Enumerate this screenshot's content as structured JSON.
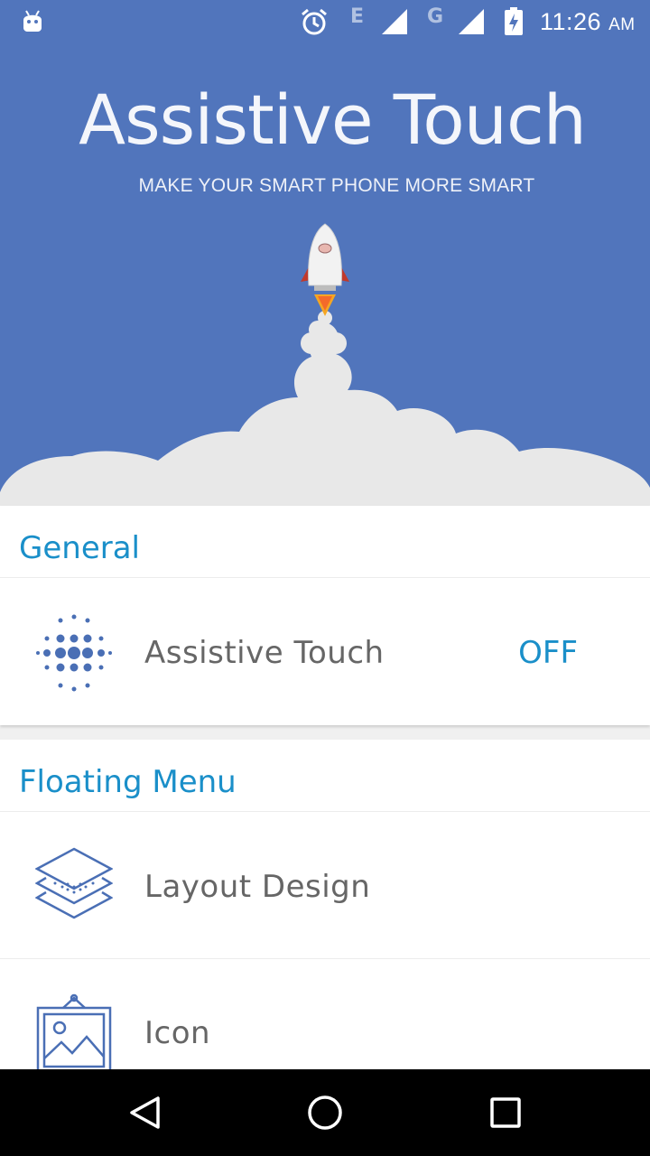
{
  "status_bar": {
    "time": "11:26",
    "ampm": "AM",
    "network_1": "E",
    "network_2": "G",
    "icons": [
      "android-icon",
      "alarm-icon",
      "signal-icon",
      "signal-icon",
      "battery-charging-icon"
    ]
  },
  "hero": {
    "title": "Assistive Touch",
    "subtitle": "MAKE YOUR SMART PHONE MORE SMART",
    "illustration": "rocket-launch-illustration"
  },
  "sections": {
    "general": {
      "title": "General",
      "assistive_touch": {
        "label": "Assistive Touch",
        "value": "OFF",
        "icon": "dots-grid-icon"
      }
    },
    "floating_menu": {
      "title": "Floating Menu",
      "layout_design": {
        "label": "Layout Design",
        "icon": "layers-icon"
      },
      "icon_item": {
        "label": "Icon",
        "icon": "picture-frame-icon"
      }
    }
  },
  "nav_bar": {
    "icons": [
      "back-icon",
      "home-icon",
      "recents-icon"
    ]
  },
  "colors": {
    "hero_bg": "#5175bc",
    "accent": "#1a8fc9",
    "icon_blue": "#4a6fb5",
    "cloud": "#e8e8e8"
  }
}
